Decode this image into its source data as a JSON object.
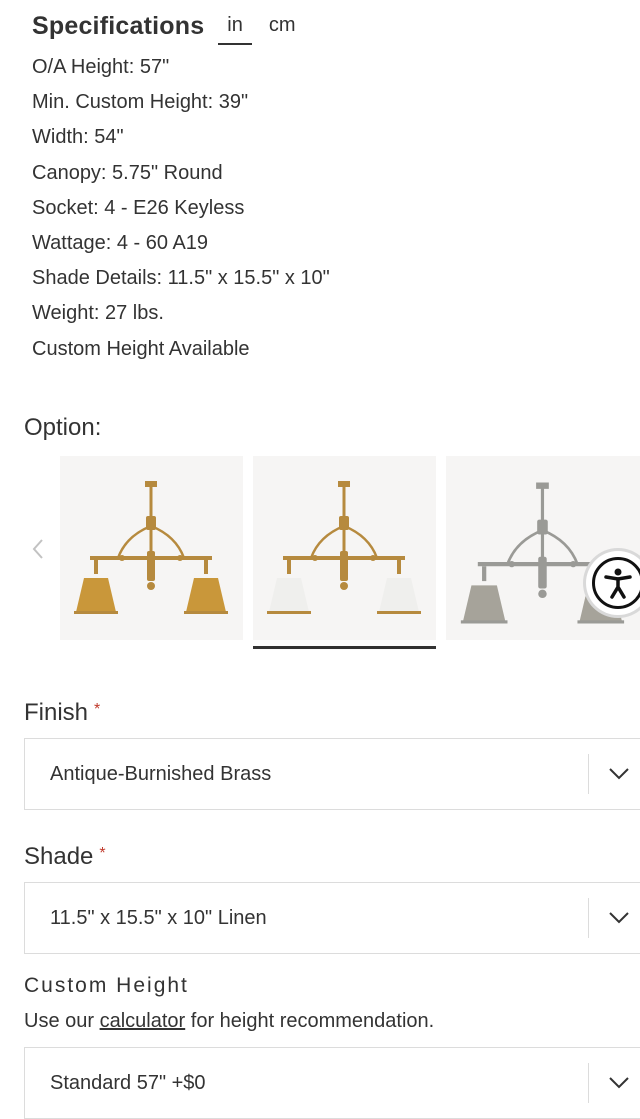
{
  "specifications": {
    "title": "Specifications",
    "units": [
      "in",
      "cm"
    ],
    "active_unit": "in",
    "items": [
      "O/A Height: 57\"",
      "Min. Custom Height: 39\"",
      "Width: 54\"",
      "Canopy: 5.75\" Round",
      "Socket: 4 - E26 Keyless",
      "Wattage: 4 - 60 A19",
      "Shade Details: 11.5\" x 15.5\" x 10\"",
      "Weight: 27 lbs.",
      "Custom Height Available"
    ]
  },
  "option": {
    "label": "Option:",
    "prev_icon": "chevron-left-icon",
    "thumbnails": [
      {
        "variant": "brass-shades",
        "metal_color": "#b68a3e",
        "shade_color": "#c9973a",
        "selected": false
      },
      {
        "variant": "linen-shades",
        "metal_color": "#b68a3e",
        "shade_color": "#efefed",
        "selected": true
      },
      {
        "variant": "nickel-shades",
        "metal_color": "#9a9a96",
        "shade_color": "#a6a39a",
        "selected": false
      }
    ]
  },
  "accessibility": {
    "icon": "accessibility-icon"
  },
  "finish": {
    "label": "Finish",
    "required_mark": "*",
    "selected_value": "Antique-Burnished Brass"
  },
  "shade": {
    "label": "Shade",
    "required_mark": "*",
    "selected_value": "11.5\" x 15.5\" x 10\" Linen"
  },
  "custom_height": {
    "label": "Custom Height",
    "helper_prefix": "Use our ",
    "helper_link": "calculator",
    "helper_suffix": " for height recommendation.",
    "selected_value": "Standard 57\" +$0"
  },
  "colors": {
    "text": "#333333",
    "required": "#c0392b",
    "border": "#dcdcdc",
    "thumb_bg": "#f6f5f4"
  }
}
